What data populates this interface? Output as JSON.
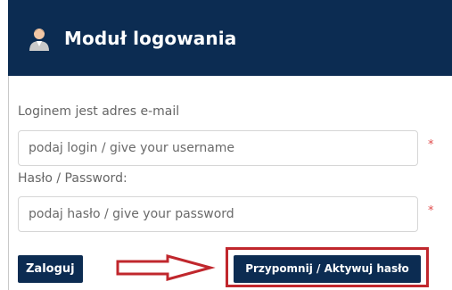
{
  "header": {
    "title": "Moduł logowania",
    "icon": "user-avatar-icon",
    "background": "#0c2c52"
  },
  "login": {
    "label": "Loginem jest adres e-mail",
    "placeholder": "podaj login / give your username",
    "required_mark": "*"
  },
  "password": {
    "label": "Hasło / Password:",
    "placeholder": "podaj hasło / give your password",
    "required_mark": "*"
  },
  "buttons": {
    "login_label": "Zaloguj",
    "remind_label": "Przypomnij / Aktywuj hasło"
  },
  "annotation": {
    "arrow_color": "#c0272d",
    "highlight_color": "#c0272d"
  }
}
